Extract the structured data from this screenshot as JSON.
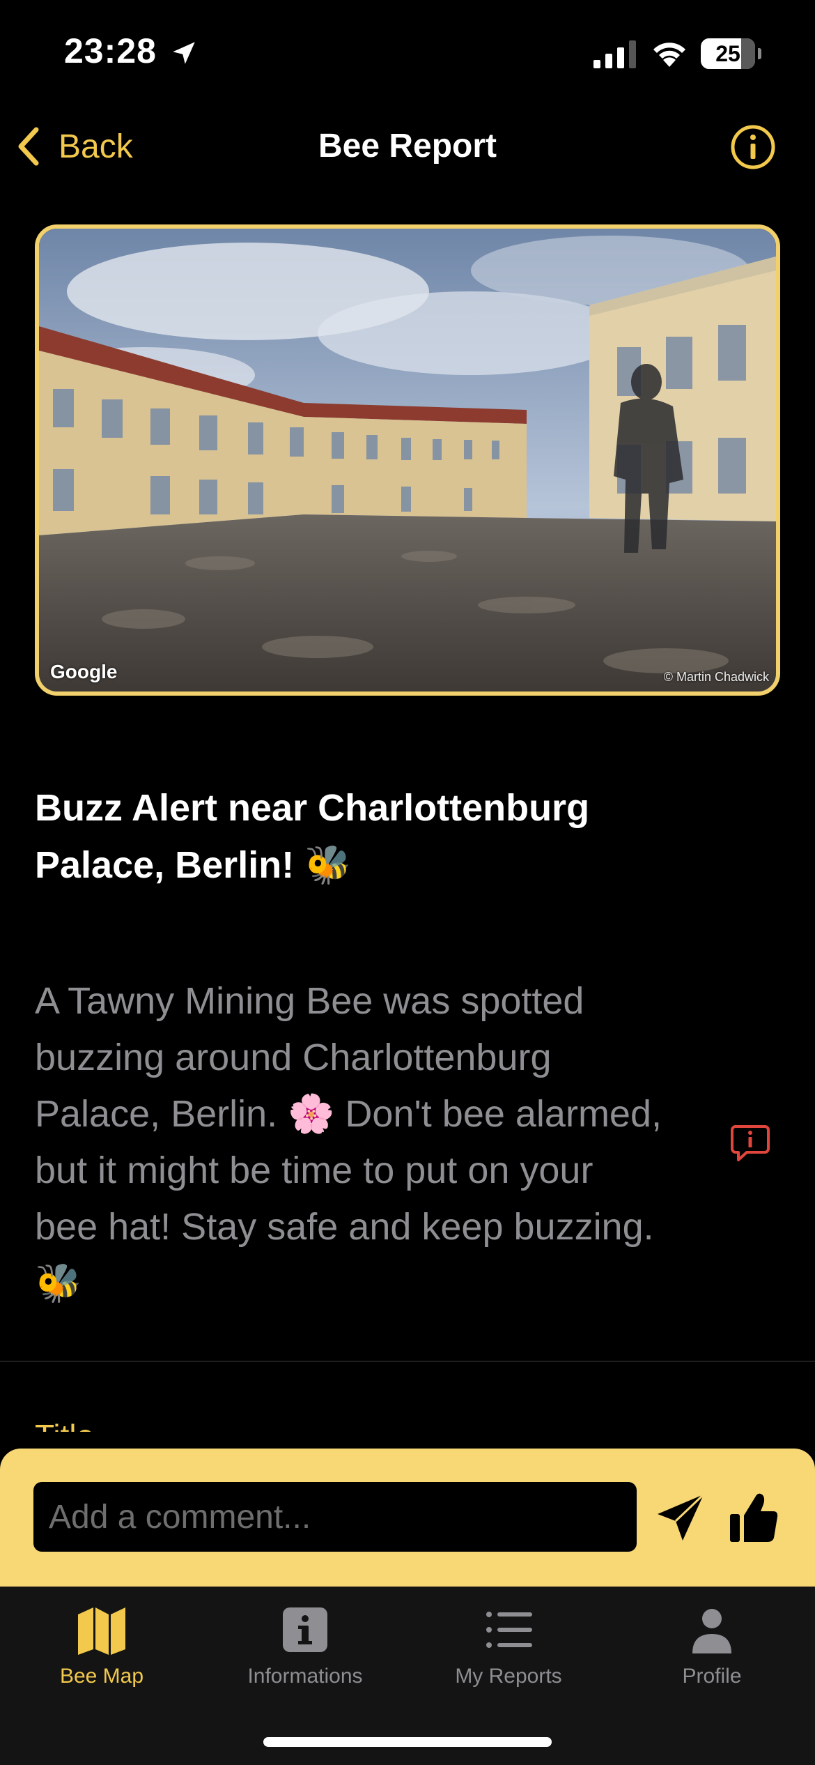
{
  "status_bar": {
    "time": "23:28",
    "battery": "25",
    "icons": [
      "location-arrow-icon",
      "cellular-signal-icon",
      "wifi-icon",
      "battery-icon"
    ]
  },
  "nav": {
    "back_label": "Back",
    "title": "Bee Report",
    "info_icon": "info-circle-icon"
  },
  "photo": {
    "watermark": "Google",
    "credit": "© Martin Chadwick"
  },
  "report": {
    "title": "Buzz Alert near Charlottenburg Palace, Berlin! 🐝",
    "body": "A Tawny Mining Bee was spotted buzzing around Charlottenburg Palace, Berlin. 🌸 Don't bee alarmed, but it might be time to put on your bee hat! Stay safe and keep buzzing. 🐝",
    "flag_icon": "report-flag-icon"
  },
  "section": {
    "label": "Title"
  },
  "comment": {
    "placeholder": "Add a comment...",
    "send_icon": "send-icon",
    "like_icon": "thumbs-up-icon"
  },
  "tabs": [
    {
      "label": "Bee Map",
      "icon": "map-icon",
      "active": true
    },
    {
      "label": "Informations",
      "icon": "info-square-icon",
      "active": false
    },
    {
      "label": "My Reports",
      "icon": "list-icon",
      "active": false
    },
    {
      "label": "Profile",
      "icon": "person-icon",
      "active": false
    }
  ],
  "colors": {
    "accent": "#f2c94c",
    "comment_bar": "#f8d775",
    "background": "#000000",
    "secondary_text": "#8e8e93",
    "flag_red": "#e0463b"
  }
}
